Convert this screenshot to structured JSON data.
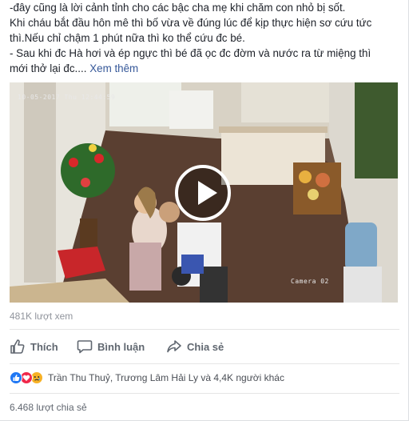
{
  "post": {
    "lines": [
      "-đây cũng là lời cảnh tỉnh cho các bậc cha mẹ khi chăm con nhỏ bị sốt.",
      "Khi cháu bắt đầu hôn mê thì bố vừa về đúng lúc để kịp thực hiện sơ cứu tức",
      "thì.Nếu chỉ chậm 1 phút nữa thì ko thể cứu đc bé.",
      "- Sau khi đc Hà hơi và ép ngực thì bé đã ọc đc đờm và nước ra từ miệng thì"
    ],
    "last_line": "mới thở lại đc....",
    "see_more": "Xem thêm"
  },
  "video": {
    "timestamp": "10-05-2017 Thu 12:44:59",
    "camera_label": "Camera 02"
  },
  "views": "481K lượt xem",
  "actions": {
    "like": "Thích",
    "comment": "Bình luận",
    "share": "Chia sẻ"
  },
  "reactions": {
    "icons": [
      "like-icon",
      "love-icon",
      "sad-icon"
    ],
    "names": "Trần Thu Thuỷ, Trương Lâm Hải Ly và 4,4K người khác"
  },
  "shares": "6.468 lượt chia sẻ",
  "colors": {
    "link": "#365899",
    "like_blue": "#2078f4",
    "love_red": "#f0284a",
    "sad_yellow": "#f7b125"
  }
}
